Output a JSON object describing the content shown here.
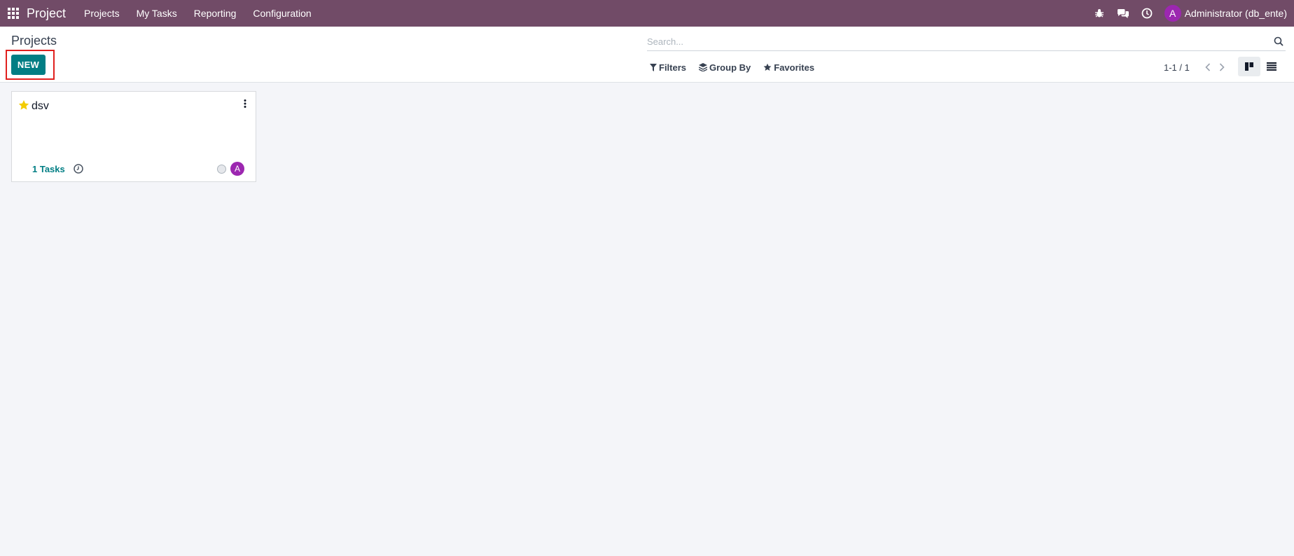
{
  "navbar": {
    "app_name": "Project",
    "menu": [
      "Projects",
      "My Tasks",
      "Reporting",
      "Configuration"
    ],
    "user": {
      "initial": "A",
      "name": "Administrator (db_ente)"
    },
    "background_color": "#714b67"
  },
  "control_panel": {
    "title": "Projects",
    "new_button": "NEW",
    "search": {
      "placeholder": "Search..."
    },
    "filters": {
      "filters_label": "Filters",
      "group_by_label": "Group By",
      "favorites_label": "Favorites"
    },
    "pager": "1-1 / 1",
    "views": [
      "kanban",
      "list"
    ],
    "active_view": "kanban"
  },
  "projects": [
    {
      "name": "dsv",
      "favorite": true,
      "tasks_label": "1 Tasks",
      "assignee_initial": "A"
    }
  ],
  "colors": {
    "accent": "#017e84",
    "avatar": "#9c27b0",
    "star": "#f3cc00",
    "highlight": "#e0201e"
  }
}
